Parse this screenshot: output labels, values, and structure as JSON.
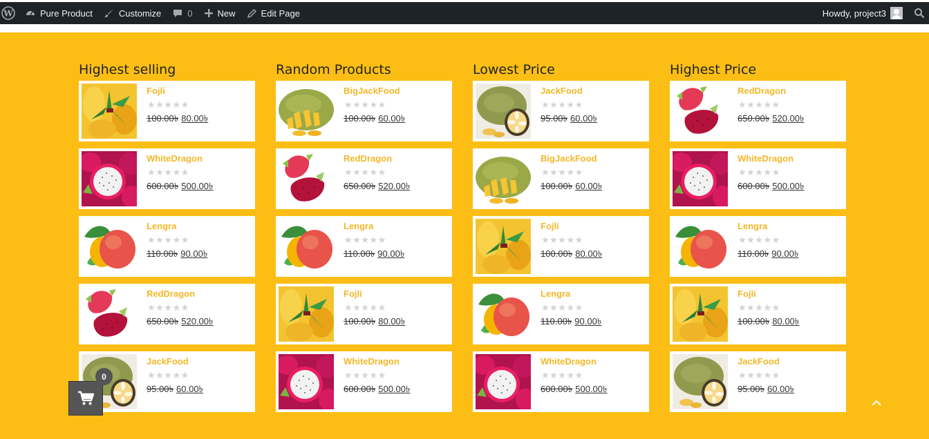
{
  "adminbar": {
    "site_name": "Pure Product",
    "customize": "Customize",
    "comments_count": "0",
    "new_label": "New",
    "edit_page": "Edit Page",
    "howdy": "Howdy, project3"
  },
  "columns": [
    {
      "title": "Highest selling",
      "products": [
        {
          "name": "Fojli",
          "old_price": "100.00৳",
          "price": "80.00৳",
          "fruit": "mango-yellow"
        },
        {
          "name": "WhiteDragon",
          "old_price": "600.00৳",
          "price": "500.00৳",
          "fruit": "white-dragon"
        },
        {
          "name": "Lengra",
          "old_price": "110.00৳",
          "price": "90.00৳",
          "fruit": "mango-red"
        },
        {
          "name": "RedDragon",
          "old_price": "650.00৳",
          "price": "520.00৳",
          "fruit": "red-dragon"
        },
        {
          "name": "JackFood",
          "old_price": "95.00৳",
          "price": "60.00৳",
          "fruit": "jackfruit"
        }
      ]
    },
    {
      "title": "Random Products",
      "products": [
        {
          "name": "BigJackFood",
          "old_price": "100.00৳",
          "price": "60.00৳",
          "fruit": "big-jackfruit"
        },
        {
          "name": "RedDragon",
          "old_price": "650.00৳",
          "price": "520.00৳",
          "fruit": "red-dragon"
        },
        {
          "name": "Lengra",
          "old_price": "110.00৳",
          "price": "90.00৳",
          "fruit": "mango-red"
        },
        {
          "name": "Fojli",
          "old_price": "100.00৳",
          "price": "80.00৳",
          "fruit": "mango-yellow"
        },
        {
          "name": "WhiteDragon",
          "old_price": "600.00৳",
          "price": "500.00৳",
          "fruit": "white-dragon"
        }
      ]
    },
    {
      "title": "Lowest Price",
      "products": [
        {
          "name": "JackFood",
          "old_price": "95.00৳",
          "price": "60.00৳",
          "fruit": "jackfruit"
        },
        {
          "name": "BigJackFood",
          "old_price": "100.00৳",
          "price": "60.00৳",
          "fruit": "big-jackfruit"
        },
        {
          "name": "Fojli",
          "old_price": "100.00৳",
          "price": "80.00৳",
          "fruit": "mango-yellow"
        },
        {
          "name": "Lengra",
          "old_price": "110.00৳",
          "price": "90.00৳",
          "fruit": "mango-red"
        },
        {
          "name": "WhiteDragon",
          "old_price": "600.00৳",
          "price": "500.00৳",
          "fruit": "white-dragon"
        }
      ]
    },
    {
      "title": "Highest Price",
      "products": [
        {
          "name": "RedDragon",
          "old_price": "650.00৳",
          "price": "520.00৳",
          "fruit": "red-dragon"
        },
        {
          "name": "WhiteDragon",
          "old_price": "600.00৳",
          "price": "500.00৳",
          "fruit": "white-dragon"
        },
        {
          "name": "Lengra",
          "old_price": "110.00৳",
          "price": "90.00৳",
          "fruit": "mango-red"
        },
        {
          "name": "Fojli",
          "old_price": "100.00৳",
          "price": "80.00৳",
          "fruit": "mango-yellow"
        },
        {
          "name": "JackFood",
          "old_price": "95.00৳",
          "price": "60.00৳",
          "fruit": "jackfruit"
        }
      ]
    }
  ],
  "cart": {
    "count": "0"
  },
  "colors": {
    "background": "#fcbe14",
    "product_name": "#f2b829",
    "adminbar": "#1d2327"
  },
  "icons": [
    "wordpress-icon",
    "dashboard-icon",
    "brush-icon",
    "comment-icon",
    "plus-icon",
    "pencil-icon",
    "search-icon",
    "cart-icon",
    "chevron-up-icon"
  ]
}
